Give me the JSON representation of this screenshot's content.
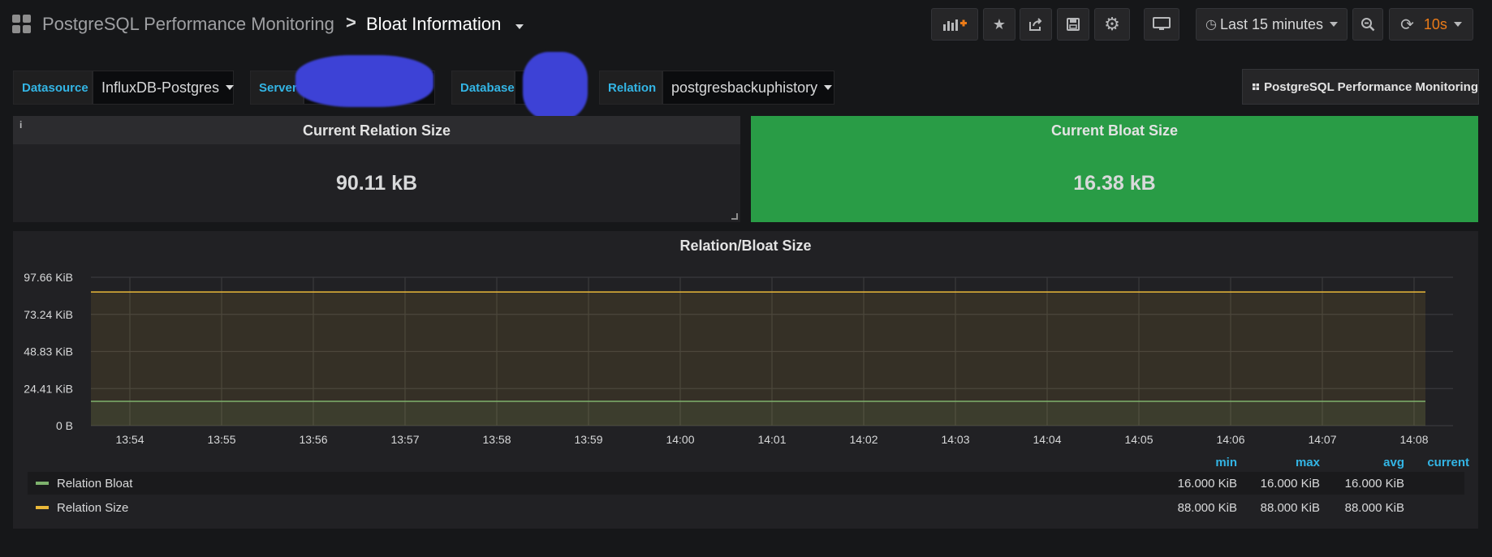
{
  "nav": {
    "parent_title": "PostgreSQL Performance Monitoring",
    "separator": ">",
    "current_title": "Bloat Information",
    "icons": [
      "grid-logo-icon",
      "add-panel-icon",
      "star-icon",
      "share-icon",
      "save-icon",
      "gear-icon",
      "tv-mode-icon",
      "clock-icon",
      "zoom-out-icon",
      "refresh-icon"
    ],
    "time_range": "Last 15 minutes",
    "refresh_interval": "10s"
  },
  "variables": [
    {
      "label": "Datasource",
      "value": "InfluxDB-Postgres"
    },
    {
      "label": "Server",
      "value": ""
    },
    {
      "label": "Database",
      "value": ""
    },
    {
      "label": "Relation",
      "value": "postgresbackuphistory"
    }
  ],
  "dashboard_link": "PostgreSQL Performance Monitoring",
  "stats": [
    {
      "title": "Current Relation Size",
      "value": "90.11 kB",
      "info_icon": "i",
      "background": "#212124",
      "value_color": "#d8d9da"
    },
    {
      "title": "Current Bloat Size",
      "value": "16.38 kB",
      "background": "#299c46",
      "value_color": "#d8d9da"
    }
  ],
  "colors": {
    "accent_blue": "#33b5e5",
    "refresh_orange": "#eb7b18",
    "ok_green": "#299c46",
    "series_bloat": "#7eb26d",
    "series_size": "#eab839"
  },
  "chart_data": {
    "type": "area",
    "title": "Relation/Bloat Size",
    "x": [
      "13:54",
      "13:55",
      "13:56",
      "13:57",
      "13:58",
      "13:59",
      "14:00",
      "14:01",
      "14:02",
      "14:03",
      "14:04",
      "14:05",
      "14:06",
      "14:07",
      "14:08"
    ],
    "y_ticks": [
      "0 B",
      "24.41 KiB",
      "48.83 KiB",
      "73.24 KiB",
      "97.66 KiB"
    ],
    "ylim": [
      0,
      97.66
    ],
    "y_unit": "KiB",
    "grid": true,
    "series": [
      {
        "name": "Relation Bloat",
        "color": "#7eb26d",
        "values": [
          16,
          16,
          16,
          16,
          16,
          16,
          16,
          16,
          16,
          16,
          16,
          16,
          16,
          16,
          16
        ],
        "min": "16.000 KiB",
        "max": "16.000 KiB",
        "avg": "16.000 KiB",
        "current": ""
      },
      {
        "name": "Relation Size",
        "color": "#eab839",
        "values": [
          88,
          88,
          88,
          88,
          88,
          88,
          88,
          88,
          88,
          88,
          88,
          88,
          88,
          88,
          88
        ],
        "min": "88.000 KiB",
        "max": "88.000 KiB",
        "avg": "88.000 KiB",
        "current": ""
      }
    ],
    "legend_columns": [
      "min",
      "max",
      "avg",
      "current"
    ],
    "legend_position": "bottom"
  }
}
